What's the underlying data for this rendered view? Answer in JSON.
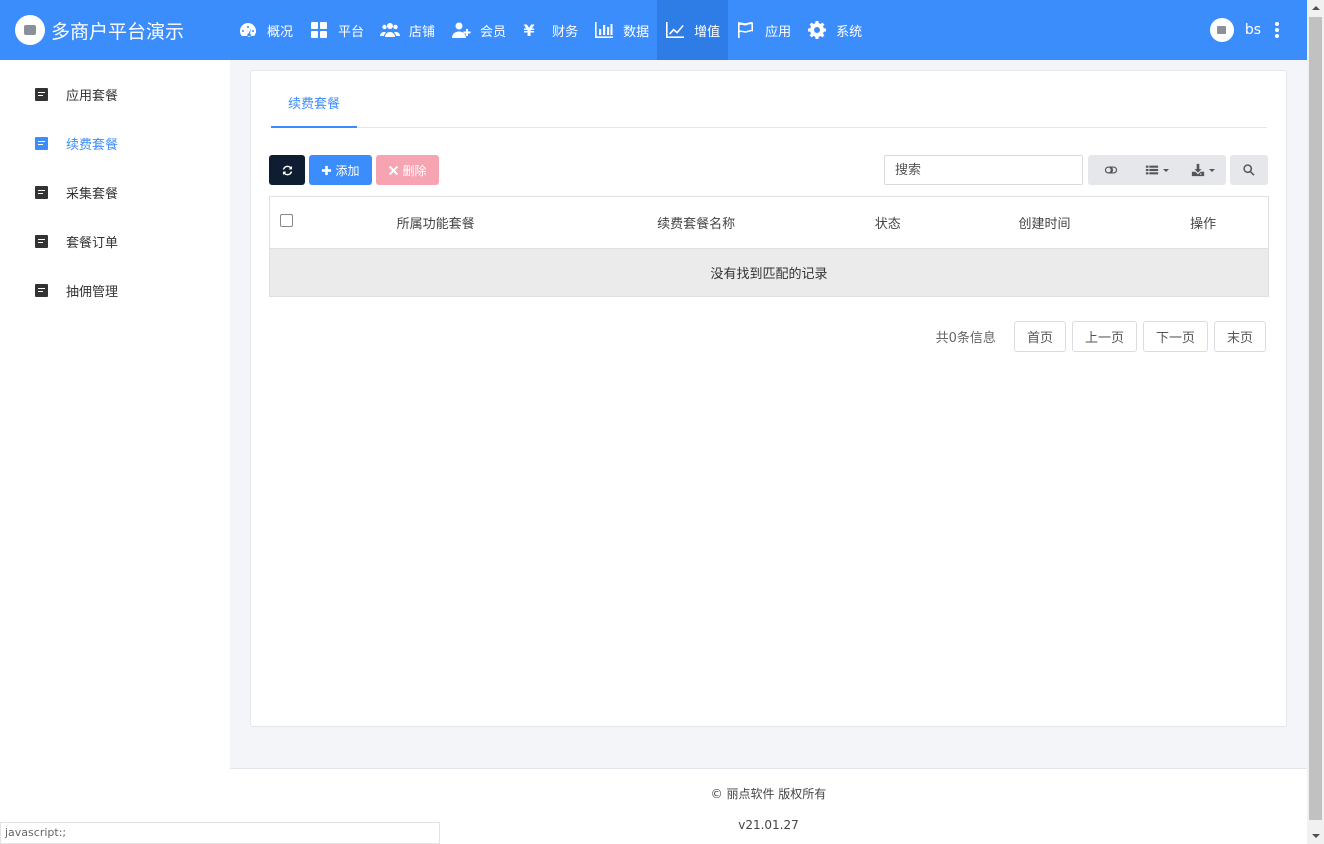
{
  "app": {
    "title": "多商户平台演示"
  },
  "nav": [
    {
      "label": "概况",
      "icon": "dashboard-icon"
    },
    {
      "label": "平台",
      "icon": "grid-icon"
    },
    {
      "label": "店铺",
      "icon": "users-icon"
    },
    {
      "label": "会员",
      "icon": "user-add-icon"
    },
    {
      "label": "财务",
      "icon": "yen-icon",
      "glyph": "¥"
    },
    {
      "label": "数据",
      "icon": "bar-chart-icon"
    },
    {
      "label": "增值",
      "icon": "line-chart-icon",
      "active": true
    },
    {
      "label": "应用",
      "icon": "flag-icon"
    },
    {
      "label": "系统",
      "icon": "gear-icon"
    }
  ],
  "user": {
    "name": "bs"
  },
  "sidebar": {
    "items": [
      {
        "label": "应用套餐"
      },
      {
        "label": "续费套餐",
        "active": true
      },
      {
        "label": "采集套餐"
      },
      {
        "label": "套餐订单"
      },
      {
        "label": "抽佣管理"
      }
    ]
  },
  "tabs": [
    {
      "label": "续费套餐"
    }
  ],
  "toolbar": {
    "add_label": "添加",
    "delete_label": "删除"
  },
  "search": {
    "placeholder": "搜索"
  },
  "table": {
    "columns": [
      "所属功能套餐",
      "续费套餐名称",
      "状态",
      "创建时间",
      "操作"
    ],
    "empty_text": "没有找到匹配的记录"
  },
  "pager": {
    "info": "共0条信息",
    "first": "首页",
    "prev": "上一页",
    "next": "下一页",
    "last": "末页"
  },
  "footer": {
    "copyright": "© 丽点软件 版权所有",
    "version": "v21.01.27"
  },
  "statusbar": {
    "text": "javascript:;"
  },
  "colors": {
    "primary": "#3c8dfc",
    "dark": "#0f1d33",
    "danger_disabled": "#f7a4b2"
  }
}
